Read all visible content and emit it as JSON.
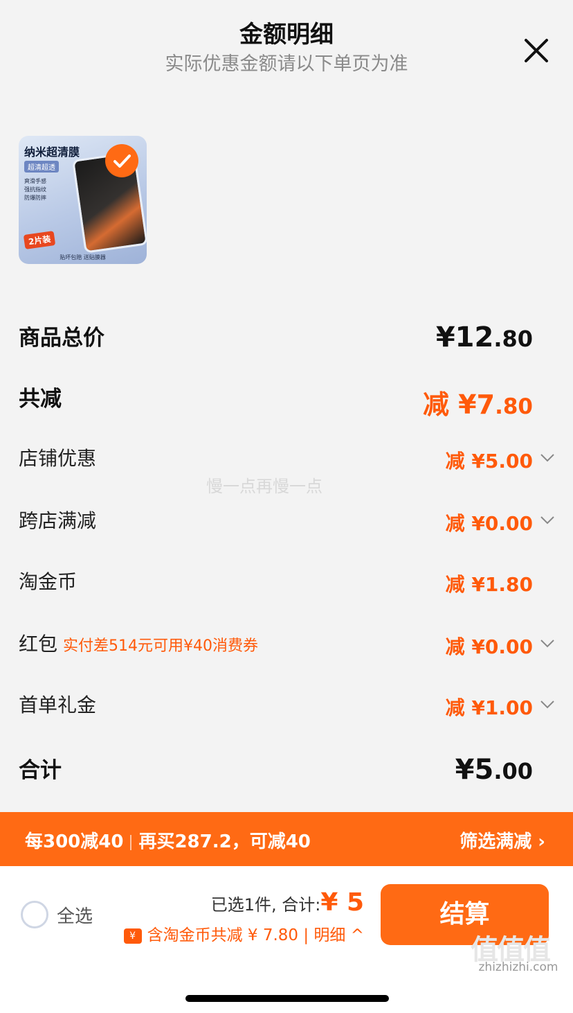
{
  "header": {
    "title": "金额明细",
    "subtitle": "实际优惠金额请以下单页为准"
  },
  "product": {
    "name": "纳米超清膜",
    "tag": "超清超透",
    "features": [
      "爽滑手感",
      "强抗指纹",
      "防爆防摔"
    ],
    "badge": "2片装",
    "footer": "贴坏包赔 送贴膜器",
    "selected": true
  },
  "breakdown": {
    "total_label": "商品总价",
    "total_amount": "¥12",
    "total_dec": ".80",
    "discount_label": "共减",
    "discount_amount": "减 ¥7",
    "discount_dec": ".80",
    "items": [
      {
        "label": "店铺优惠",
        "amount": "减 ¥5.00"
      },
      {
        "label": "跨店满减",
        "amount": "减 ¥0.00"
      },
      {
        "label": "淘金币",
        "amount": "减 ¥1.80"
      },
      {
        "label": "红包",
        "note": "实付差514元可用¥40消费券",
        "amount": "减 ¥0.00"
      },
      {
        "label": "首单礼金",
        "amount": "减 ¥1.00"
      }
    ],
    "sum_label": "合计",
    "sum_amount": "¥5",
    "sum_dec": ".00"
  },
  "watermark": "慢一点再慢一点",
  "promo": {
    "left_a": "每300减40",
    "left_b": "再买287.2，可减40",
    "right": "筛选满减 ›"
  },
  "footer": {
    "select_all": "全选",
    "selected_text": "已选1件, 合计:",
    "total_price": "¥ 5",
    "coin_icon": "¥",
    "coin_text": "含淘金币共减 ¥ 7.80 | 明细 ^",
    "checkout": "结算"
  },
  "site_watermark": {
    "logo": "值值值",
    "url": "zhizhizhi.com"
  },
  "colors": {
    "accent": "#ff6a14",
    "discount": "#ff5a0a"
  }
}
